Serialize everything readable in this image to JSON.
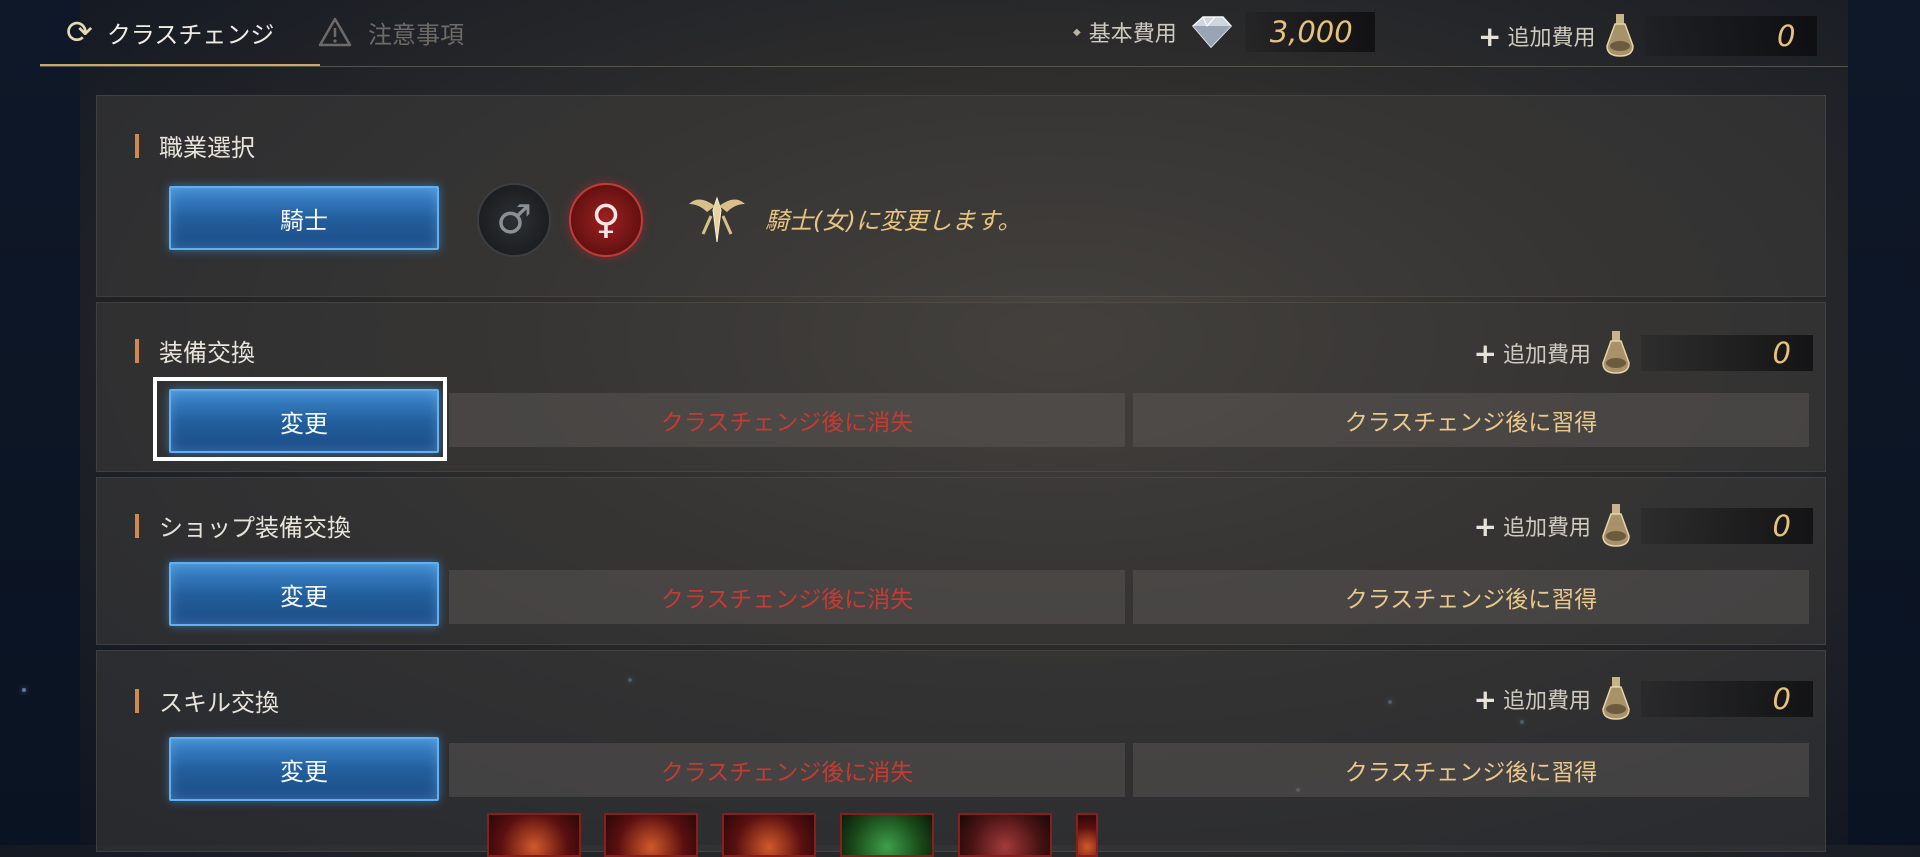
{
  "tabs": {
    "active_label": "クラスチェンジ",
    "inactive_label": "注意事項"
  },
  "header": {
    "base_cost_label": "基本費用",
    "base_cost_value": "3,000",
    "add_cost_label": "追加費用",
    "add_cost_value": "0"
  },
  "job_select": {
    "title": "職業選択",
    "class_button": "騎士",
    "male_symbol": "♂",
    "female_symbol": "♀",
    "message": "騎士(女)に変更します。"
  },
  "sections": [
    {
      "title": "装備交換",
      "add_cost_label": "追加費用",
      "add_cost_value": "0",
      "change_button": "変更",
      "lose_label": "クラスチェンジ後に消失",
      "learn_label": "クラスチェンジ後に習得"
    },
    {
      "title": "ショップ装備交換",
      "add_cost_label": "追加費用",
      "add_cost_value": "0",
      "change_button": "変更",
      "lose_label": "クラスチェンジ後に消失",
      "learn_label": "クラスチェンジ後に習得"
    },
    {
      "title": "スキル交換",
      "add_cost_label": "追加費用",
      "add_cost_value": "0",
      "change_button": "変更",
      "lose_label": "クラスチェンジ後に消失",
      "learn_label": "クラスチェンジ後に習得"
    }
  ],
  "colors": {
    "accent_gold": "#e8c27a",
    "lose_red": "#c63a33",
    "button_blue": "#235f9e"
  }
}
